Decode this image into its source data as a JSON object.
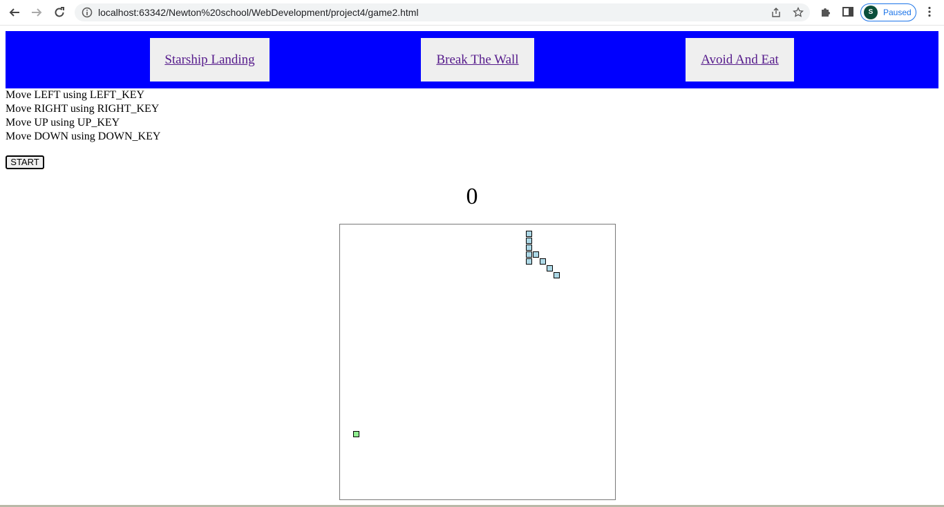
{
  "browser": {
    "url": "localhost:63342/Newton%20school/WebDevelopment/project4/game2.html",
    "profile_initial": "S",
    "profile_status": "Paused",
    "icons": [
      "back-arrow-icon",
      "forward-arrow-icon",
      "reload-icon",
      "site-info-icon",
      "share-icon",
      "bookmark-star-icon",
      "extensions-puzzle-icon",
      "side-panel-icon",
      "more-menu-icon"
    ]
  },
  "nav": {
    "links": [
      "Starship Landing",
      "Break The Wall",
      "Avoid And Eat"
    ],
    "background": "#0000ff"
  },
  "instructions": [
    "Move LEFT using LEFT_KEY",
    "Move RIGHT using RIGHT_KEY",
    "Move UP using UP_KEY",
    "Move DOWN using DOWN_KEY"
  ],
  "controls": {
    "start_label": "START"
  },
  "game": {
    "score": "0",
    "snake_color": "#add8e6",
    "food_color": "#90ee90"
  }
}
